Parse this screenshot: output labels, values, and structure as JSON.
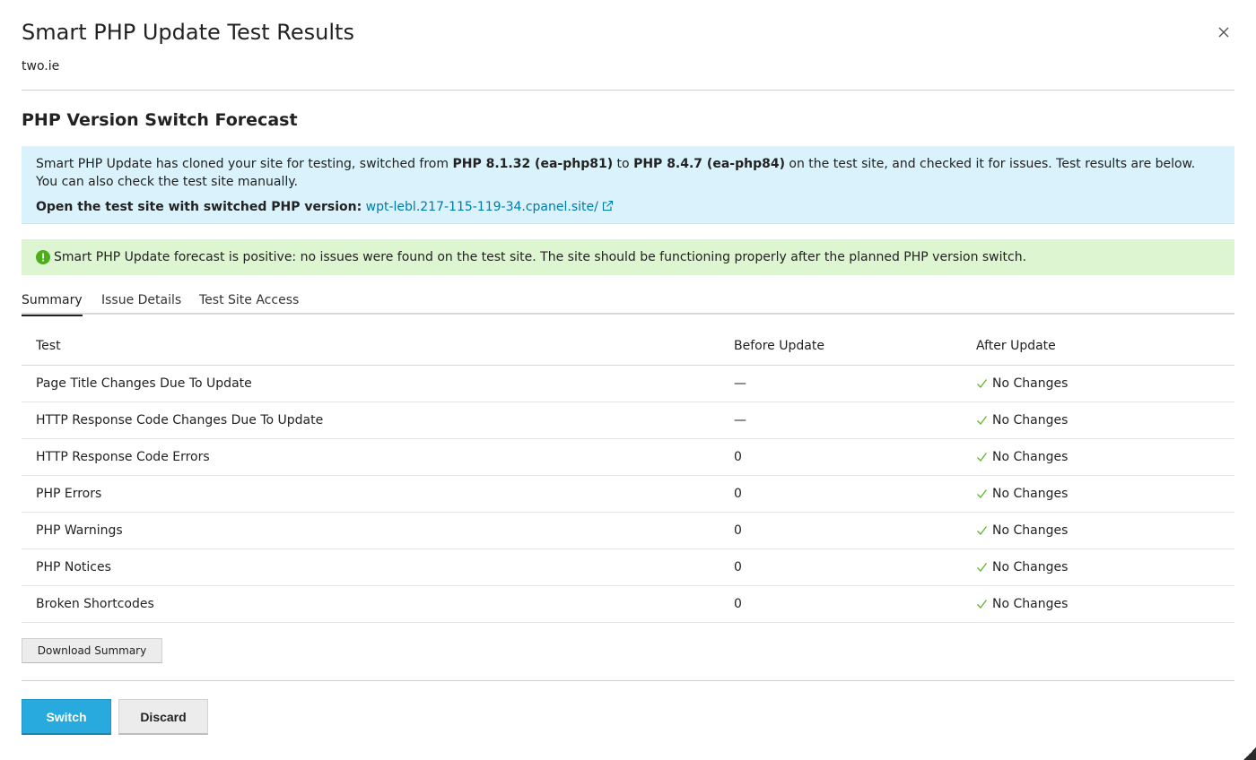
{
  "dialog": {
    "title": "Smart PHP Update Test Results",
    "domain": "two.ie",
    "close_icon": "close-icon"
  },
  "forecast": {
    "heading": "PHP Version Switch Forecast",
    "info": {
      "text_1": "Smart PHP Update has cloned your site for testing, switched from ",
      "from_version": "PHP 8.1.32 (ea-php81)",
      "text_2": " to ",
      "to_version": "PHP 8.4.7 (ea-php84)",
      "text_3": " on the test site, and checked it for issues. Test results are below. You can also check the test site manually.",
      "open_label": "Open the test site with switched PHP version:",
      "test_site_link": "wpt-lebl.217-115-119-34.cpanel.site/",
      "link_icon": "external-link-icon"
    },
    "success_message": "Smart PHP Update forecast is positive: no issues were found on the test site. The site should be functioning properly after the planned PHP version switch.",
    "success_icon": "exclamation-circle-icon",
    "success_color": "#4caf1a"
  },
  "tabs": [
    {
      "label": "Summary",
      "active": true
    },
    {
      "label": "Issue Details",
      "active": false
    },
    {
      "label": "Test Site Access",
      "active": false
    }
  ],
  "table": {
    "headers": [
      "Test",
      "Before Update",
      "After Update"
    ],
    "rows": [
      {
        "test": "Page Title Changes Due To Update",
        "before": "—",
        "after": "No Changes"
      },
      {
        "test": "HTTP Response Code Changes Due To Update",
        "before": "—",
        "after": "No Changes"
      },
      {
        "test": "HTTP Response Code Errors",
        "before": "0",
        "after": "No Changes"
      },
      {
        "test": "PHP Errors",
        "before": "0",
        "after": "No Changes"
      },
      {
        "test": "PHP Warnings",
        "before": "0",
        "after": "No Changes"
      },
      {
        "test": "PHP Notices",
        "before": "0",
        "after": "No Changes"
      },
      {
        "test": "Broken Shortcodes",
        "before": "0",
        "after": "No Changes"
      }
    ],
    "check_icon": "checkmark-icon",
    "check_color": "#5cb82a"
  },
  "buttons": {
    "download_summary": "Download Summary",
    "switch": "Switch",
    "discard": "Discard"
  },
  "colors": {
    "info_bg": "#d9f2fc",
    "success_bg": "#def5d2",
    "primary": "#28aade",
    "link": "#007aa7"
  }
}
